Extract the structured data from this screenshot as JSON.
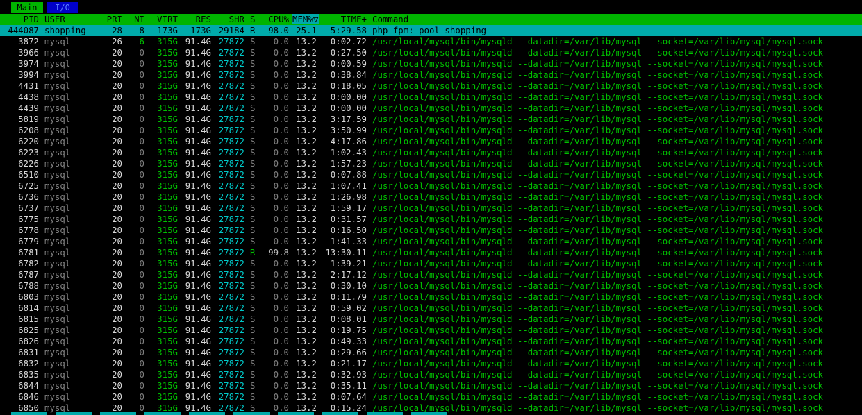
{
  "tabs": [
    {
      "label": "Main"
    },
    {
      "label": "I/O"
    }
  ],
  "header": {
    "pid": "PID",
    "user": "USER",
    "pri": "PRI",
    "ni": "NI",
    "virt": "VIRT",
    "res": "RES",
    "shr": "SHR",
    "s": "S",
    "cpu": "CPU%",
    "mem": "MEM%▽",
    "time": "TIME+",
    "command": "Command"
  },
  "processes": [
    {
      "pid": "444087",
      "user": "shopping",
      "pri": "28",
      "ni": "8",
      "virt": "173G",
      "res": "173G",
      "shr": "29184",
      "s": "R",
      "cpu": "98.0",
      "mem": "25.1",
      "time": "5:29.58",
      "command": "php-fpm: pool shopping",
      "selected": true
    },
    {
      "pid": "3872",
      "user": "mysql",
      "pri": "26",
      "ni": "6",
      "virt": "315G",
      "res": "91.4G",
      "shr": "27872",
      "s": "S",
      "cpu": "0.0",
      "mem": "13.2",
      "time": "0:02.72",
      "command": "/usr/local/mysql/bin/mysqld --datadir=/var/lib/mysql --socket=/var/lib/mysql/mysql.sock"
    },
    {
      "pid": "3966",
      "user": "mysql",
      "pri": "20",
      "ni": "0",
      "virt": "315G",
      "res": "91.4G",
      "shr": "27872",
      "s": "S",
      "cpu": "0.0",
      "mem": "13.2",
      "time": "0:27.50",
      "command": "/usr/local/mysql/bin/mysqld --datadir=/var/lib/mysql --socket=/var/lib/mysql/mysql.sock"
    },
    {
      "pid": "3974",
      "user": "mysql",
      "pri": "20",
      "ni": "0",
      "virt": "315G",
      "res": "91.4G",
      "shr": "27872",
      "s": "S",
      "cpu": "0.0",
      "mem": "13.2",
      "time": "0:00.59",
      "command": "/usr/local/mysql/bin/mysqld --datadir=/var/lib/mysql --socket=/var/lib/mysql/mysql.sock"
    },
    {
      "pid": "3994",
      "user": "mysql",
      "pri": "20",
      "ni": "0",
      "virt": "315G",
      "res": "91.4G",
      "shr": "27872",
      "s": "S",
      "cpu": "0.0",
      "mem": "13.2",
      "time": "0:38.84",
      "command": "/usr/local/mysql/bin/mysqld --datadir=/var/lib/mysql --socket=/var/lib/mysql/mysql.sock"
    },
    {
      "pid": "4431",
      "user": "mysql",
      "pri": "20",
      "ni": "0",
      "virt": "315G",
      "res": "91.4G",
      "shr": "27872",
      "s": "S",
      "cpu": "0.0",
      "mem": "13.2",
      "time": "0:18.05",
      "command": "/usr/local/mysql/bin/mysqld --datadir=/var/lib/mysql --socket=/var/lib/mysql/mysql.sock"
    },
    {
      "pid": "4438",
      "user": "mysql",
      "pri": "20",
      "ni": "0",
      "virt": "315G",
      "res": "91.4G",
      "shr": "27872",
      "s": "S",
      "cpu": "0.0",
      "mem": "13.2",
      "time": "0:00.00",
      "command": "/usr/local/mysql/bin/mysqld --datadir=/var/lib/mysql --socket=/var/lib/mysql/mysql.sock"
    },
    {
      "pid": "4439",
      "user": "mysql",
      "pri": "20",
      "ni": "0",
      "virt": "315G",
      "res": "91.4G",
      "shr": "27872",
      "s": "S",
      "cpu": "0.0",
      "mem": "13.2",
      "time": "0:00.00",
      "command": "/usr/local/mysql/bin/mysqld --datadir=/var/lib/mysql --socket=/var/lib/mysql/mysql.sock"
    },
    {
      "pid": "5819",
      "user": "mysql",
      "pri": "20",
      "ni": "0",
      "virt": "315G",
      "res": "91.4G",
      "shr": "27872",
      "s": "S",
      "cpu": "0.0",
      "mem": "13.2",
      "time": "3:17.59",
      "command": "/usr/local/mysql/bin/mysqld --datadir=/var/lib/mysql --socket=/var/lib/mysql/mysql.sock"
    },
    {
      "pid": "6208",
      "user": "mysql",
      "pri": "20",
      "ni": "0",
      "virt": "315G",
      "res": "91.4G",
      "shr": "27872",
      "s": "S",
      "cpu": "0.0",
      "mem": "13.2",
      "time": "3:50.99",
      "command": "/usr/local/mysql/bin/mysqld --datadir=/var/lib/mysql --socket=/var/lib/mysql/mysql.sock"
    },
    {
      "pid": "6220",
      "user": "mysql",
      "pri": "20",
      "ni": "0",
      "virt": "315G",
      "res": "91.4G",
      "shr": "27872",
      "s": "S",
      "cpu": "0.0",
      "mem": "13.2",
      "time": "4:17.86",
      "command": "/usr/local/mysql/bin/mysqld --datadir=/var/lib/mysql --socket=/var/lib/mysql/mysql.sock"
    },
    {
      "pid": "6223",
      "user": "mysql",
      "pri": "20",
      "ni": "0",
      "virt": "315G",
      "res": "91.4G",
      "shr": "27872",
      "s": "S",
      "cpu": "0.0",
      "mem": "13.2",
      "time": "1:02.43",
      "command": "/usr/local/mysql/bin/mysqld --datadir=/var/lib/mysql --socket=/var/lib/mysql/mysql.sock"
    },
    {
      "pid": "6226",
      "user": "mysql",
      "pri": "20",
      "ni": "0",
      "virt": "315G",
      "res": "91.4G",
      "shr": "27872",
      "s": "S",
      "cpu": "0.0",
      "mem": "13.2",
      "time": "1:57.23",
      "command": "/usr/local/mysql/bin/mysqld --datadir=/var/lib/mysql --socket=/var/lib/mysql/mysql.sock"
    },
    {
      "pid": "6510",
      "user": "mysql",
      "pri": "20",
      "ni": "0",
      "virt": "315G",
      "res": "91.4G",
      "shr": "27872",
      "s": "S",
      "cpu": "0.0",
      "mem": "13.2",
      "time": "0:07.88",
      "command": "/usr/local/mysql/bin/mysqld --datadir=/var/lib/mysql --socket=/var/lib/mysql/mysql.sock"
    },
    {
      "pid": "6725",
      "user": "mysql",
      "pri": "20",
      "ni": "0",
      "virt": "315G",
      "res": "91.4G",
      "shr": "27872",
      "s": "S",
      "cpu": "0.0",
      "mem": "13.2",
      "time": "1:07.41",
      "command": "/usr/local/mysql/bin/mysqld --datadir=/var/lib/mysql --socket=/var/lib/mysql/mysql.sock"
    },
    {
      "pid": "6736",
      "user": "mysql",
      "pri": "20",
      "ni": "0",
      "virt": "315G",
      "res": "91.4G",
      "shr": "27872",
      "s": "S",
      "cpu": "0.0",
      "mem": "13.2",
      "time": "1:26.98",
      "command": "/usr/local/mysql/bin/mysqld --datadir=/var/lib/mysql --socket=/var/lib/mysql/mysql.sock"
    },
    {
      "pid": "6737",
      "user": "mysql",
      "pri": "20",
      "ni": "0",
      "virt": "315G",
      "res": "91.4G",
      "shr": "27872",
      "s": "S",
      "cpu": "0.0",
      "mem": "13.2",
      "time": "1:59.17",
      "command": "/usr/local/mysql/bin/mysqld --datadir=/var/lib/mysql --socket=/var/lib/mysql/mysql.sock"
    },
    {
      "pid": "6775",
      "user": "mysql",
      "pri": "20",
      "ni": "0",
      "virt": "315G",
      "res": "91.4G",
      "shr": "27872",
      "s": "S",
      "cpu": "0.0",
      "mem": "13.2",
      "time": "0:31.57",
      "command": "/usr/local/mysql/bin/mysqld --datadir=/var/lib/mysql --socket=/var/lib/mysql/mysql.sock"
    },
    {
      "pid": "6778",
      "user": "mysql",
      "pri": "20",
      "ni": "0",
      "virt": "315G",
      "res": "91.4G",
      "shr": "27872",
      "s": "S",
      "cpu": "0.0",
      "mem": "13.2",
      "time": "0:16.50",
      "command": "/usr/local/mysql/bin/mysqld --datadir=/var/lib/mysql --socket=/var/lib/mysql/mysql.sock"
    },
    {
      "pid": "6779",
      "user": "mysql",
      "pri": "20",
      "ni": "0",
      "virt": "315G",
      "res": "91.4G",
      "shr": "27872",
      "s": "S",
      "cpu": "0.0",
      "mem": "13.2",
      "time": "1:41.33",
      "command": "/usr/local/mysql/bin/mysqld --datadir=/var/lib/mysql --socket=/var/lib/mysql/mysql.sock"
    },
    {
      "pid": "6781",
      "user": "mysql",
      "pri": "20",
      "ni": "0",
      "virt": "315G",
      "res": "91.4G",
      "shr": "27872",
      "s": "R",
      "cpu": "99.8",
      "mem": "13.2",
      "time": "13:30.11",
      "command": "/usr/local/mysql/bin/mysqld --datadir=/var/lib/mysql --socket=/var/lib/mysql/mysql.sock"
    },
    {
      "pid": "6782",
      "user": "mysql",
      "pri": "20",
      "ni": "0",
      "virt": "315G",
      "res": "91.4G",
      "shr": "27872",
      "s": "S",
      "cpu": "0.0",
      "mem": "13.2",
      "time": "1:39.21",
      "command": "/usr/local/mysql/bin/mysqld --datadir=/var/lib/mysql --socket=/var/lib/mysql/mysql.sock"
    },
    {
      "pid": "6787",
      "user": "mysql",
      "pri": "20",
      "ni": "0",
      "virt": "315G",
      "res": "91.4G",
      "shr": "27872",
      "s": "S",
      "cpu": "0.0",
      "mem": "13.2",
      "time": "2:17.12",
      "command": "/usr/local/mysql/bin/mysqld --datadir=/var/lib/mysql --socket=/var/lib/mysql/mysql.sock"
    },
    {
      "pid": "6788",
      "user": "mysql",
      "pri": "20",
      "ni": "0",
      "virt": "315G",
      "res": "91.4G",
      "shr": "27872",
      "s": "S",
      "cpu": "0.0",
      "mem": "13.2",
      "time": "0:30.10",
      "command": "/usr/local/mysql/bin/mysqld --datadir=/var/lib/mysql --socket=/var/lib/mysql/mysql.sock"
    },
    {
      "pid": "6803",
      "user": "mysql",
      "pri": "20",
      "ni": "0",
      "virt": "315G",
      "res": "91.4G",
      "shr": "27872",
      "s": "S",
      "cpu": "0.0",
      "mem": "13.2",
      "time": "0:11.79",
      "command": "/usr/local/mysql/bin/mysqld --datadir=/var/lib/mysql --socket=/var/lib/mysql/mysql.sock"
    },
    {
      "pid": "6814",
      "user": "mysql",
      "pri": "20",
      "ni": "0",
      "virt": "315G",
      "res": "91.4G",
      "shr": "27872",
      "s": "S",
      "cpu": "0.0",
      "mem": "13.2",
      "time": "0:59.02",
      "command": "/usr/local/mysql/bin/mysqld --datadir=/var/lib/mysql --socket=/var/lib/mysql/mysql.sock"
    },
    {
      "pid": "6815",
      "user": "mysql",
      "pri": "20",
      "ni": "0",
      "virt": "315G",
      "res": "91.4G",
      "shr": "27872",
      "s": "S",
      "cpu": "0.0",
      "mem": "13.2",
      "time": "0:08.01",
      "command": "/usr/local/mysql/bin/mysqld --datadir=/var/lib/mysql --socket=/var/lib/mysql/mysql.sock"
    },
    {
      "pid": "6825",
      "user": "mysql",
      "pri": "20",
      "ni": "0",
      "virt": "315G",
      "res": "91.4G",
      "shr": "27872",
      "s": "S",
      "cpu": "0.0",
      "mem": "13.2",
      "time": "0:19.75",
      "command": "/usr/local/mysql/bin/mysqld --datadir=/var/lib/mysql --socket=/var/lib/mysql/mysql.sock"
    },
    {
      "pid": "6826",
      "user": "mysql",
      "pri": "20",
      "ni": "0",
      "virt": "315G",
      "res": "91.4G",
      "shr": "27872",
      "s": "S",
      "cpu": "0.0",
      "mem": "13.2",
      "time": "0:49.33",
      "command": "/usr/local/mysql/bin/mysqld --datadir=/var/lib/mysql --socket=/var/lib/mysql/mysql.sock"
    },
    {
      "pid": "6831",
      "user": "mysql",
      "pri": "20",
      "ni": "0",
      "virt": "315G",
      "res": "91.4G",
      "shr": "27872",
      "s": "S",
      "cpu": "0.0",
      "mem": "13.2",
      "time": "0:29.66",
      "command": "/usr/local/mysql/bin/mysqld --datadir=/var/lib/mysql --socket=/var/lib/mysql/mysql.sock"
    },
    {
      "pid": "6832",
      "user": "mysql",
      "pri": "20",
      "ni": "0",
      "virt": "315G",
      "res": "91.4G",
      "shr": "27872",
      "s": "S",
      "cpu": "0.0",
      "mem": "13.2",
      "time": "0:21.17",
      "command": "/usr/local/mysql/bin/mysqld --datadir=/var/lib/mysql --socket=/var/lib/mysql/mysql.sock"
    },
    {
      "pid": "6835",
      "user": "mysql",
      "pri": "20",
      "ni": "0",
      "virt": "315G",
      "res": "91.4G",
      "shr": "27872",
      "s": "S",
      "cpu": "0.0",
      "mem": "13.2",
      "time": "0:32.93",
      "command": "/usr/local/mysql/bin/mysqld --datadir=/var/lib/mysql --socket=/var/lib/mysql/mysql.sock"
    },
    {
      "pid": "6844",
      "user": "mysql",
      "pri": "20",
      "ni": "0",
      "virt": "315G",
      "res": "91.4G",
      "shr": "27872",
      "s": "S",
      "cpu": "0.0",
      "mem": "13.2",
      "time": "0:35.11",
      "command": "/usr/local/mysql/bin/mysqld --datadir=/var/lib/mysql --socket=/var/lib/mysql/mysql.sock"
    },
    {
      "pid": "6846",
      "user": "mysql",
      "pri": "20",
      "ni": "0",
      "virt": "315G",
      "res": "91.4G",
      "shr": "27872",
      "s": "S",
      "cpu": "0.0",
      "mem": "13.2",
      "time": "0:07.64",
      "command": "/usr/local/mysql/bin/mysqld --datadir=/var/lib/mysql --socket=/var/lib/mysql/mysql.sock"
    },
    {
      "pid": "6850",
      "user": "mysql",
      "pri": "20",
      "ni": "0",
      "virt": "315G",
      "res": "91.4G",
      "shr": "27872",
      "s": "S",
      "cpu": "0.0",
      "mem": "13.2",
      "time": "0:15.24",
      "command": "/usr/local/mysql/bin/mysqld --datadir=/var/lib/mysql --socket=/var/lib/mysql/mysql.sock"
    }
  ]
}
